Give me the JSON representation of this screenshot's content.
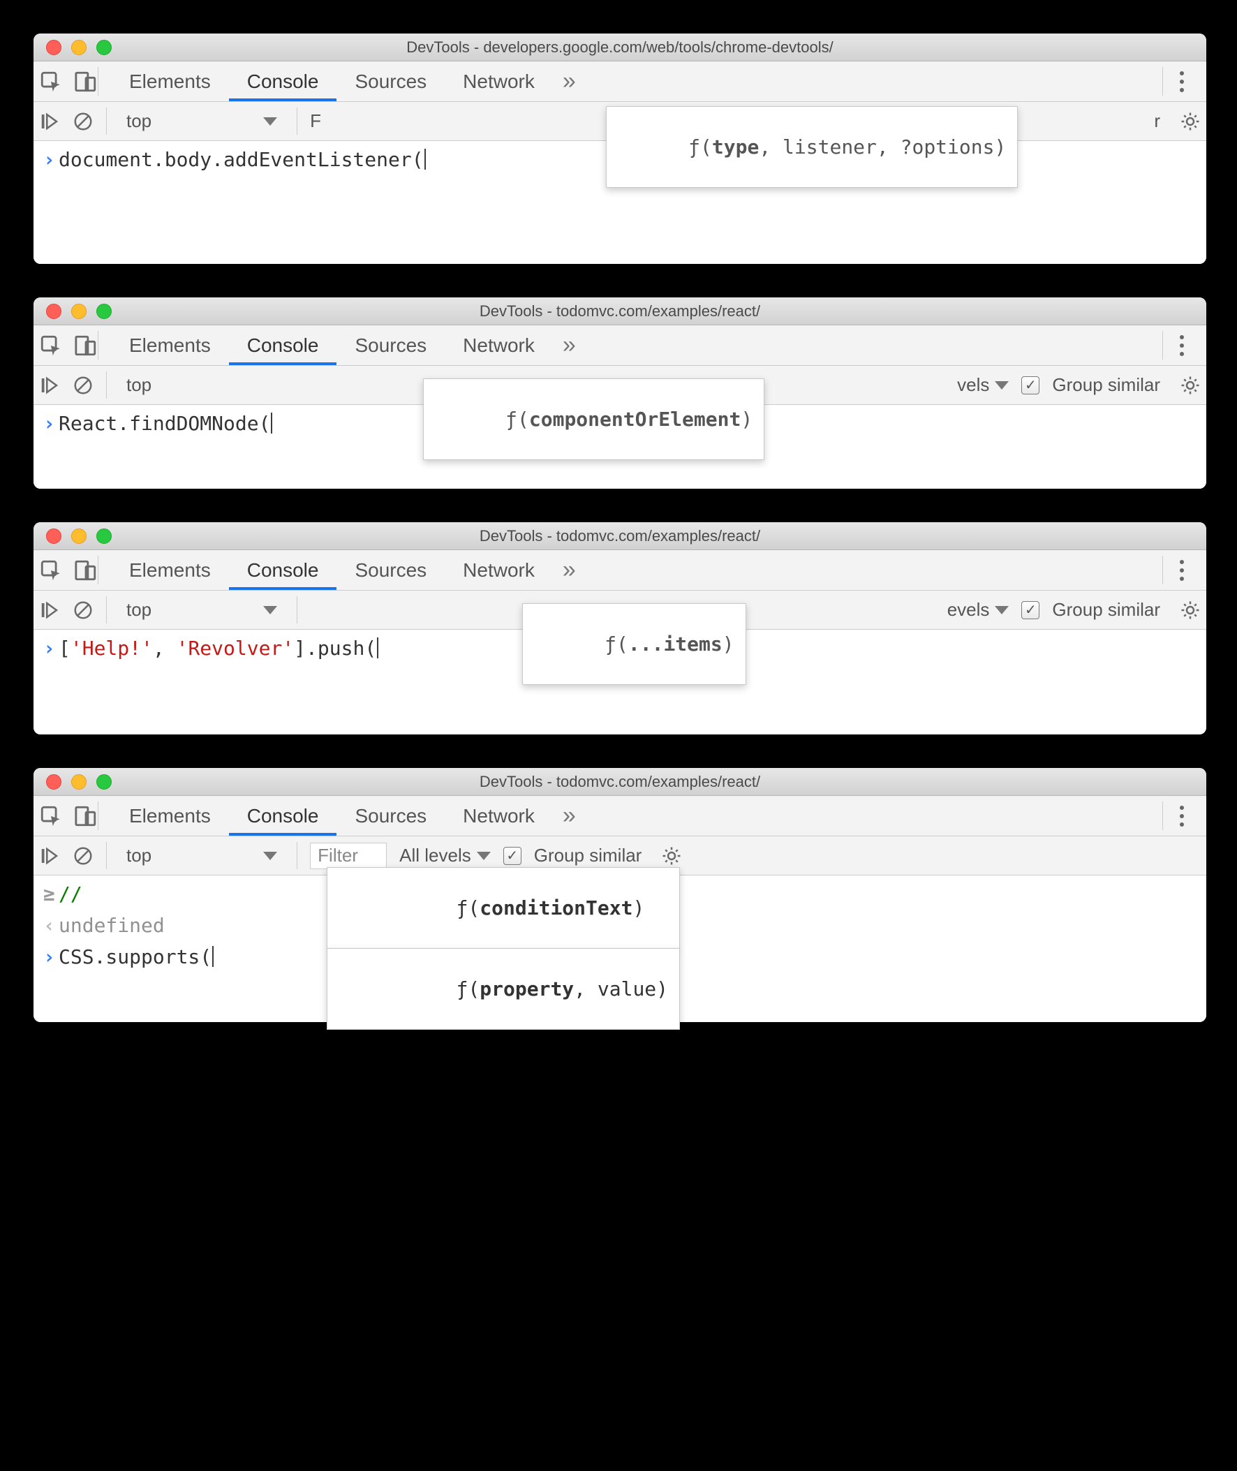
{
  "windows": [
    {
      "title": "DevTools - developers.google.com/web/tools/chrome-devtools/",
      "tabs": [
        "Elements",
        "Console",
        "Sources",
        "Network"
      ],
      "active_tab": "Console",
      "context": "top",
      "filter_placeholder": "F",
      "levels_label": "",
      "group_similar": "",
      "signature": {
        "prefix": "ƒ(",
        "bold": "type",
        "rest": ", listener, ?options)"
      },
      "code": {
        "pre": "document.body.addEventListener(",
        "post": ""
      }
    },
    {
      "title": "DevTools - todomvc.com/examples/react/",
      "tabs": [
        "Elements",
        "Console",
        "Sources",
        "Network"
      ],
      "active_tab": "Console",
      "context": "top",
      "levels_label": "vels",
      "group_similar": "Group similar",
      "signature": {
        "prefix": "ƒ(",
        "bold": "componentOrElement",
        "rest": ")"
      },
      "code": {
        "pre": "React.findDOMNode(",
        "post": ""
      }
    },
    {
      "title": "DevTools - todomvc.com/examples/react/",
      "tabs": [
        "Elements",
        "Console",
        "Sources",
        "Network"
      ],
      "active_tab": "Console",
      "context": "top",
      "levels_label": "evels",
      "group_similar": "Group similar",
      "signature": {
        "prefix": "ƒ(",
        "bold": "...items",
        "rest": ")"
      },
      "code_segments": [
        "[",
        "'Help!'",
        ", ",
        "'Revolver'",
        "].push("
      ]
    },
    {
      "title": "DevTools - todomvc.com/examples/react/",
      "tabs": [
        "Elements",
        "Console",
        "Sources",
        "Network"
      ],
      "active_tab": "Console",
      "context": "top",
      "filter_placeholder": "Filter",
      "levels_label": "All levels",
      "group_similar": "Group similar",
      "signatures": [
        {
          "prefix": "ƒ(",
          "bold": "conditionText",
          "rest": ")"
        },
        {
          "prefix": "ƒ(",
          "bold": "property",
          "rest": ", value)"
        }
      ],
      "lines": [
        {
          "gutter": "⪾",
          "kind": "in",
          "text": "//"
        },
        {
          "gutter": "⋖",
          "kind": "out",
          "text": "undefined"
        }
      ],
      "code": {
        "pre": "CSS.supports(",
        "post": ""
      }
    }
  ]
}
